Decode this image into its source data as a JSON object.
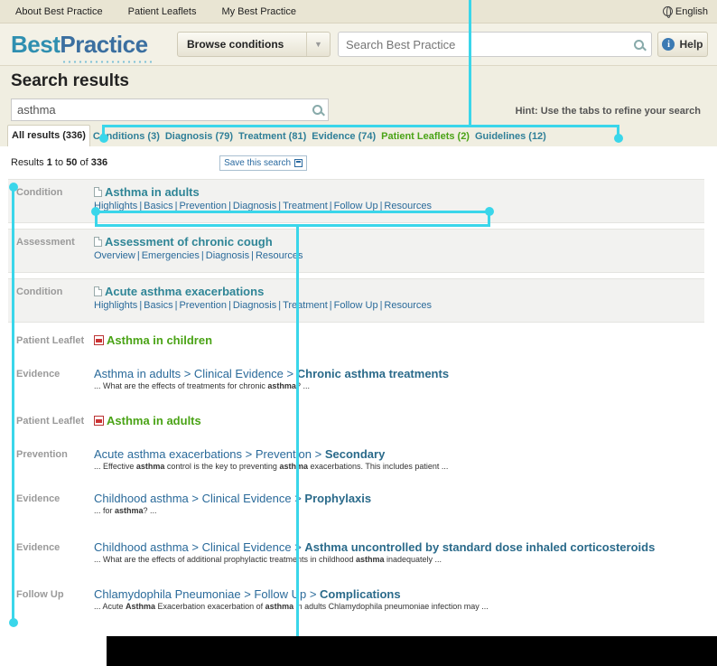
{
  "topbar": {
    "links": [
      "About Best Practice",
      "Patient Leaflets",
      "My Best Practice"
    ],
    "language": "English"
  },
  "header": {
    "logo_part1": "Best",
    "logo_part2": "Practice",
    "browse_label": "Browse conditions",
    "search_placeholder": "Search Best Practice",
    "help_label": "Help"
  },
  "search": {
    "heading": "Search results",
    "query": "asthma",
    "hint": "Hint: Use the tabs to refine your search"
  },
  "tabs": [
    {
      "label": "All results (336)",
      "active": true
    },
    {
      "label": "Conditions (3)"
    },
    {
      "label": "Diagnosis (79)"
    },
    {
      "label": "Treatment (81)"
    },
    {
      "label": "Evidence (74)"
    },
    {
      "label": "Patient Leaflets (2)"
    },
    {
      "label": "Guidelines (12)"
    }
  ],
  "meta": {
    "prefix": "Results ",
    "from": "1",
    "to_word": " to ",
    "to": "50",
    "of_word": " of ",
    "total": "336",
    "save_label": "Save this search"
  },
  "results": [
    {
      "category": "Condition",
      "title": "Asthma in adults",
      "links": [
        "Highlights",
        "Basics",
        "Prevention",
        "Diagnosis",
        "Treatment",
        "Follow Up",
        "Resources"
      ]
    },
    {
      "category": "Assessment",
      "title": "Assessment of chronic cough",
      "links": [
        "Overview",
        "Emergencies",
        "Diagnosis",
        "Resources"
      ]
    },
    {
      "category": "Condition",
      "title": "Acute asthma exacerbations",
      "links": [
        "Highlights",
        "Basics",
        "Prevention",
        "Diagnosis",
        "Treatment",
        "Follow Up",
        "Resources"
      ]
    },
    {
      "category": "Patient Leaflet",
      "title": "Asthma in children"
    },
    {
      "category": "Evidence",
      "path": "Asthma in adults > Clinical Evidence > ",
      "path_last": "Chronic asthma treatments",
      "snippet_a": "... What are the effects of treatments for chronic ",
      "snippet_b": "asthma",
      "snippet_c": "? ..."
    },
    {
      "category": "Patient Leaflet",
      "title": "Asthma in adults"
    },
    {
      "category": "Prevention",
      "path": "Acute asthma exacerbations > Prevention > ",
      "path_last": "Secondary",
      "snippet_a": "... Effective ",
      "snippet_b": "asthma",
      "snippet_c": " control is the key to preventing ",
      "snippet_d": "asthma",
      "snippet_e": " exacerbations. This includes patient ..."
    },
    {
      "category": "Evidence",
      "path": "Childhood asthma > Clinical Evidence > ",
      "path_last": "Prophylaxis",
      "snippet_a": "... for ",
      "snippet_b": "asthma",
      "snippet_c": "? ..."
    },
    {
      "category": "Evidence",
      "path": "Childhood asthma > Clinical Evidence > ",
      "path_last": "Asthma uncontrolled by standard dose inhaled corticosteroids",
      "snippet_a": "... What are the effects of additional prophylactic treatments in childhood ",
      "snippet_b": "asthma",
      "snippet_c": " inadequately ..."
    },
    {
      "category": "Follow Up",
      "path": "Chlamydophila Pneumoniae > Follow Up > ",
      "path_last": "Complications",
      "snippet_a": "... Acute ",
      "snippet_b": "Asthma",
      "snippet_c": " Exacerbation exacerbation of ",
      "snippet_d": "asthma",
      "snippet_e": " in adults Chlamydophila pneumoniae infection may ..."
    }
  ],
  "colors": {
    "annotation": "#3ad6ea",
    "link_teal": "#2f8596",
    "leaflet_green": "#4aa316"
  }
}
